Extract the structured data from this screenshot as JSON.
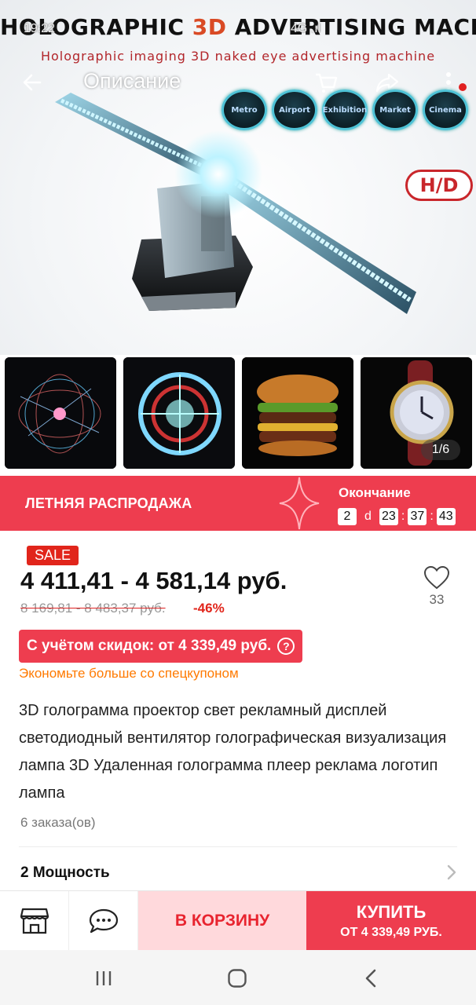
{
  "status": {
    "time": "19:22",
    "signal": "4G .ıl"
  },
  "banner": {
    "title_part1": "HOLOGRAPHIC ",
    "title_accent": "3D",
    "title_part2": " ADVERTISING MACHINE",
    "subtitle": "Holographic imaging 3D naked eye advertising machine",
    "venues": [
      "Metro",
      "Airport",
      "Exhibition",
      "Market",
      "Cinema"
    ],
    "hd_badge": "H/D"
  },
  "nav": {
    "title": "Описание"
  },
  "gallery": {
    "counter": "1/6"
  },
  "sale_banner": {
    "title": "ЛЕТНЯЯ РАСПРОДАЖА",
    "ends_label": "Окончание",
    "days": "2",
    "day_unit": "d",
    "hours": "23",
    "minutes": "37",
    "seconds": "43"
  },
  "price": {
    "sale_tag": "SALE",
    "range": "4 411,41 - 4 581,14 руб.",
    "old_range": "8 169,81 - 8 483,37 руб.",
    "discount": "-46%",
    "with_discount": "С учётом скидок: от 4 339,49 руб.",
    "help_icon": "?",
    "coupon_note": "Экономьте больше со спецкупоном"
  },
  "wishlist": {
    "count": "33"
  },
  "product": {
    "description": "3D голограмма проектор свет рекламный дисплей светодиодный вентилятор голографическая визуализация лампа 3D Удаленная голограмма плеер реклама логотип лампа",
    "orders": "6 заказа(ов)",
    "spec_label": "2 Мощность"
  },
  "bottom_bar": {
    "add_to_cart": "В КОРЗИНУ",
    "buy": "КУПИТЬ",
    "buy_price": "ОТ 4 339,49 РУБ."
  },
  "colors": {
    "accent_red": "#ee3d4f",
    "sale_tag_red": "#e1251b",
    "cart_button_bg": "#ffd9dc",
    "coupon_orange": "#ff7a00"
  }
}
